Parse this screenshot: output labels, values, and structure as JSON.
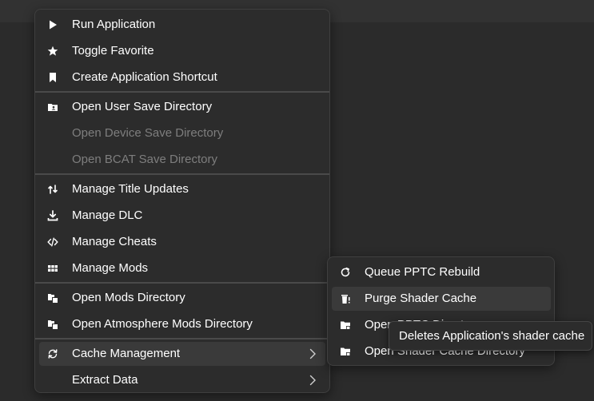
{
  "context_menu": {
    "items": [
      {
        "label": "Run Application",
        "icon": "play-icon"
      },
      {
        "label": "Toggle Favorite",
        "icon": "star-icon"
      },
      {
        "label": "Create Application Shortcut",
        "icon": "bookmark-icon"
      },
      {
        "label": "Open User Save Directory",
        "icon": "user-folder-icon"
      },
      {
        "label": "Open Device Save Directory",
        "icon": "none",
        "disabled": true
      },
      {
        "label": "Open BCAT Save Directory",
        "icon": "none",
        "disabled": true
      },
      {
        "label": "Manage Title Updates",
        "icon": "updates-icon"
      },
      {
        "label": "Manage DLC",
        "icon": "download-icon"
      },
      {
        "label": "Manage Cheats",
        "icon": "code-icon"
      },
      {
        "label": "Manage Mods",
        "icon": "grid-icon"
      },
      {
        "label": "Open Mods Directory",
        "icon": "folder-copy-icon"
      },
      {
        "label": "Open Atmosphere Mods Directory",
        "icon": "folder-copy-icon"
      },
      {
        "label": "Cache Management",
        "icon": "sync-icon",
        "has_submenu": true,
        "highlighted": true
      },
      {
        "label": "Extract Data",
        "icon": "none",
        "has_submenu": true
      }
    ]
  },
  "cache_submenu": {
    "items": [
      {
        "label": "Queue PPTC Rebuild",
        "icon": "refresh-icon"
      },
      {
        "label": "Purge Shader Cache",
        "icon": "trash-icon",
        "highlighted": true
      },
      {
        "label": "Open PPTC Directory",
        "icon": "folder-icon"
      },
      {
        "label": "Open Shader Cache Directory",
        "icon": "folder-icon"
      }
    ]
  },
  "tooltip": {
    "text": "Deletes Application's shader cache"
  },
  "colors": {
    "background": "#2b2b2b",
    "menu": "#2c2c2c",
    "hover": "#3a3a3a",
    "disabled_text": "#7e7e7e"
  }
}
